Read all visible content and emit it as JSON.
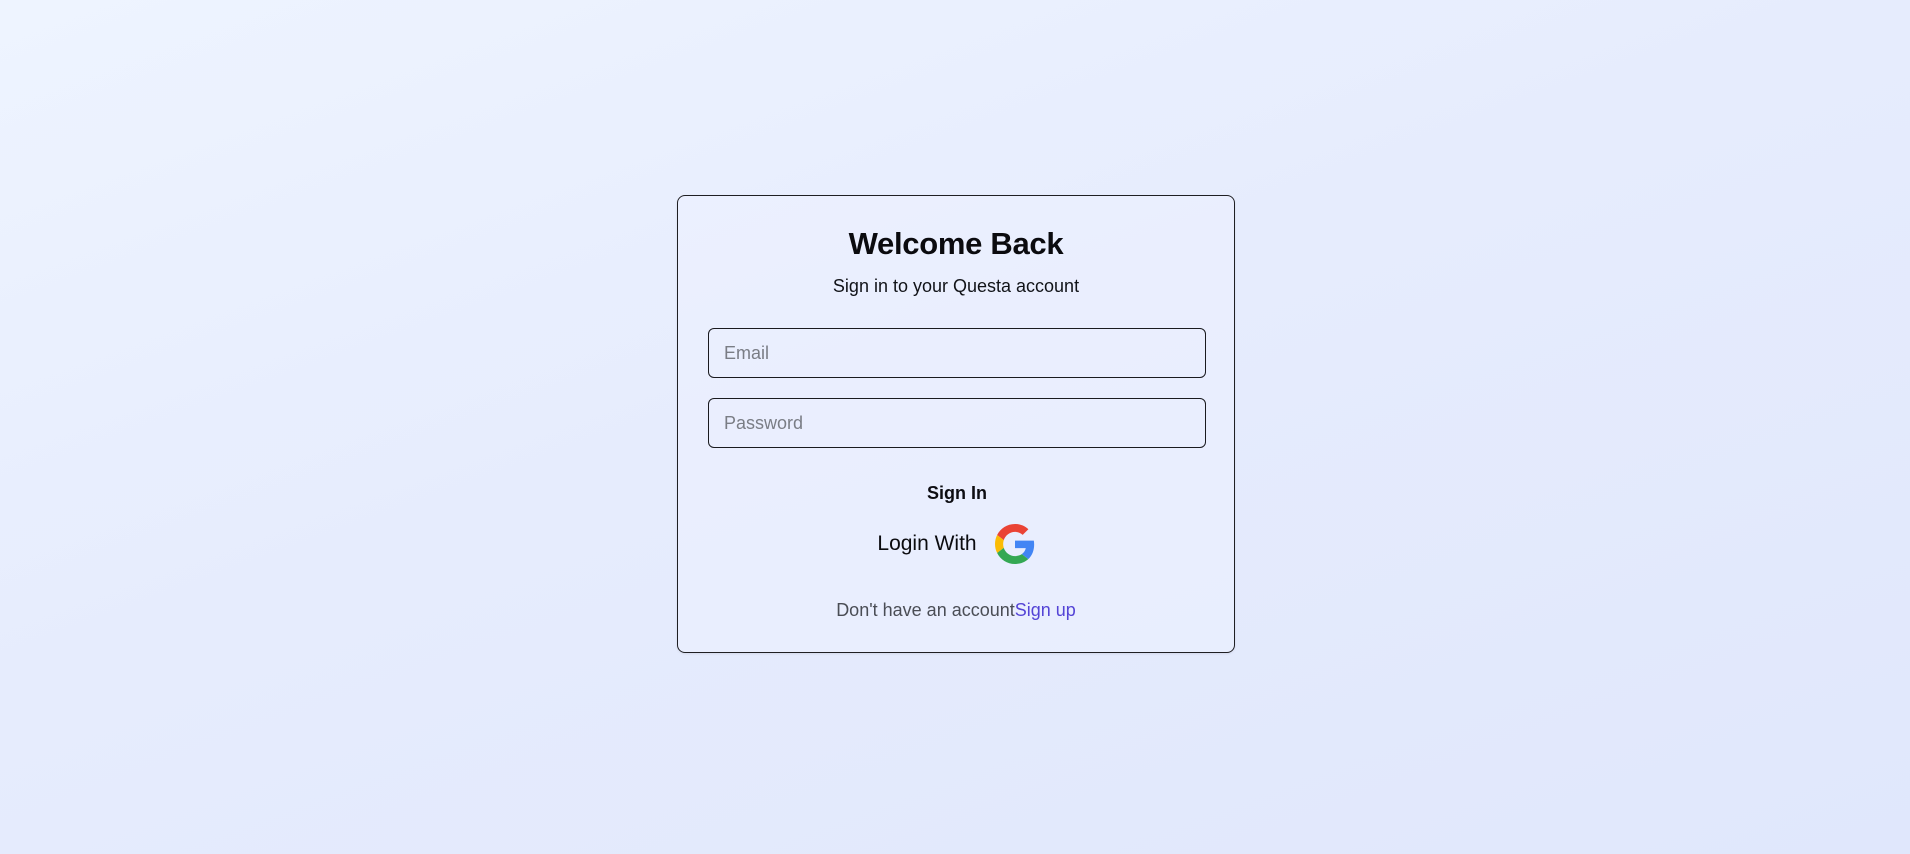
{
  "login_card": {
    "title": "Welcome Back",
    "subtitle": "Sign in to your Questa account",
    "email_placeholder": "Email",
    "email_value": "",
    "password_placeholder": "Password",
    "password_value": "",
    "signin_label": "Sign In",
    "google_label": "Login With",
    "google_icon": "google-logo-icon",
    "footer_text": "Don't have an account",
    "signup_label": "Sign up"
  },
  "colors": {
    "link": "#5444d6",
    "border": "#1f1f23",
    "background_start": "#eef4ff",
    "background_end": "#e0e7fc"
  }
}
